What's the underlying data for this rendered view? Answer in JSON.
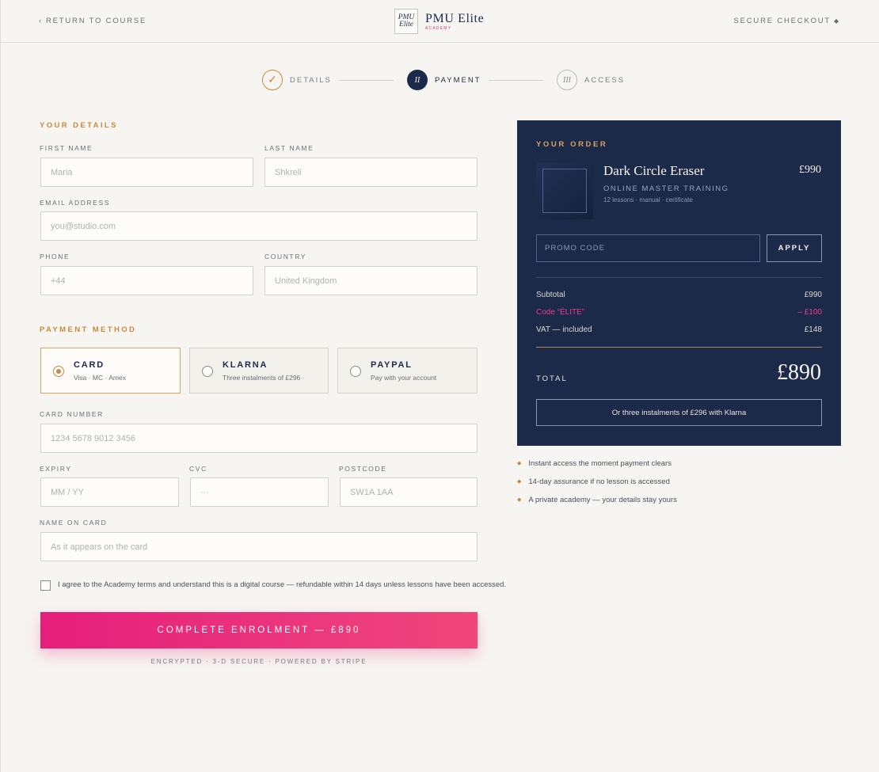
{
  "header": {
    "back_label": "RETURN TO COURSE",
    "brand_mark": "PMU Elite",
    "brand_name": "PMU Elite",
    "brand_sub": "ACADEMY",
    "secure_label": "SECURE CHECKOUT"
  },
  "steps": [
    {
      "label": "DETAILS",
      "marker": "✓",
      "state": "done"
    },
    {
      "label": "PAYMENT",
      "marker": "II",
      "state": "active"
    },
    {
      "label": "ACCESS",
      "marker": "III",
      "state": "todo"
    }
  ],
  "details": {
    "title": "YOUR DETAILS",
    "first_name": {
      "label": "FIRST NAME",
      "placeholder": "Maria"
    },
    "last_name": {
      "label": "LAST NAME",
      "placeholder": "Shkreli"
    },
    "email": {
      "label": "EMAIL ADDRESS",
      "placeholder": "you@studio.com"
    },
    "phone": {
      "label": "PHONE",
      "placeholder": "+44"
    },
    "country": {
      "label": "COUNTRY",
      "placeholder": "United Kingdom"
    }
  },
  "payment": {
    "title": "PAYMENT METHOD",
    "methods": [
      {
        "title": "CARD",
        "sub": "Visa · MC · Amex",
        "selected": true
      },
      {
        "title": "KLARNA",
        "sub": "Three instalments of £296",
        "selected": false
      },
      {
        "title": "PAYPAL",
        "sub": "Pay with your account",
        "selected": false
      }
    ],
    "card_number": {
      "label": "CARD NUMBER",
      "placeholder": "1234 5678 9012 3456"
    },
    "expiry": {
      "label": "EXPIRY",
      "placeholder": "MM / YY"
    },
    "cvc": {
      "label": "CVC",
      "placeholder": "···"
    },
    "postcode": {
      "label": "POSTCODE",
      "placeholder": "SW1A 1AA"
    },
    "name_on_card": {
      "label": "NAME ON CARD",
      "placeholder": "As it appears on the card"
    }
  },
  "terms": "I agree to the Academy terms and understand this is a digital course — refundable within 14 days unless lessons have been accessed.",
  "submit_label": "COMPLETE ENROLMENT — £890",
  "secure_note": "ENCRYPTED · 3-D SECURE · POWERED BY STRIPE",
  "order": {
    "title": "YOUR ORDER",
    "product_name": "Dark Circle Eraser",
    "product_price": "£990",
    "product_kind": "ONLINE MASTER TRAINING",
    "product_meta": "12 lessons · manual · certificate",
    "promo_placeholder": "PROMO CODE",
    "apply_label": "APPLY",
    "rows": [
      {
        "label": "Subtotal",
        "value": "£990"
      },
      {
        "label": "Code “ÉLITE”",
        "value": "– £100"
      },
      {
        "label": "VAT — included",
        "value": "£148"
      }
    ],
    "total_label": "TOTAL",
    "total_value": "£890",
    "klarna_label": "Or three instalments of £296 with Klarna"
  },
  "assurances": [
    "Instant access the moment payment clears",
    "14-day assurance if no lesson is accessed",
    "A private academy — your details stay yours"
  ],
  "colors": {
    "navy": "#1c2a4a",
    "gold": "#c98a3f",
    "pink": "#e51e7b",
    "background": "#f7f5f1"
  }
}
